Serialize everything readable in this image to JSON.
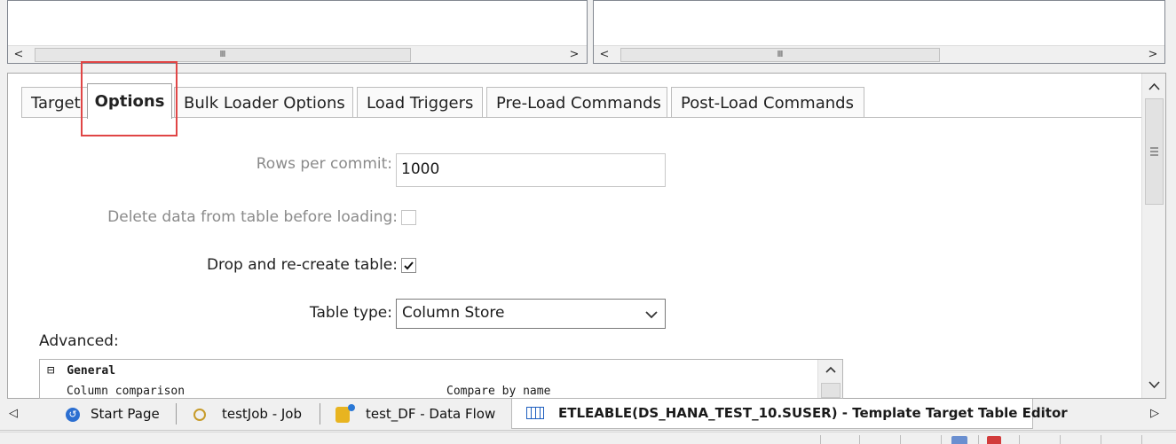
{
  "top_panes": {
    "left_thumb": "Ⅲ",
    "right_thumb": "Ⅲ",
    "arrow_left": "<",
    "arrow_right": ">"
  },
  "editor": {
    "tabs": [
      "Target",
      "Options",
      "Bulk Loader Options",
      "Load Triggers",
      "Pre-Load Commands",
      "Post-Load Commands"
    ],
    "rows_per_commit_label": "Rows per commit:",
    "rows_per_commit_value": "1000",
    "delete_data_label": "Delete data from table before loading:",
    "delete_data_checked": false,
    "drop_recreate_label": "Drop and re-create table:",
    "drop_recreate_checked": true,
    "table_type_label": "Table type:",
    "table_type_value": "Column Store",
    "advanced_label": "Advanced:",
    "grid": {
      "group_toggle": "⊟",
      "group_name": "General",
      "rows": [
        {
          "name": "Column comparison",
          "value": "Compare by name"
        }
      ]
    }
  },
  "bottom_tabs": {
    "items": [
      {
        "label": "Start Page",
        "icon": "start-page-icon"
      },
      {
        "label": "testJob - Job",
        "icon": "job-icon"
      },
      {
        "label": "test_DF - Data Flow",
        "icon": "data-flow-icon"
      },
      {
        "label": "ETLEABLE(DS_HANA_TEST_10.SUSER) - Template Target Table Editor",
        "icon": "table-editor-icon"
      }
    ],
    "nav_left": "◁",
    "nav_right": "▷"
  },
  "colors": {
    "highlight_box": "#e04545",
    "background": "#f0f0f0"
  }
}
